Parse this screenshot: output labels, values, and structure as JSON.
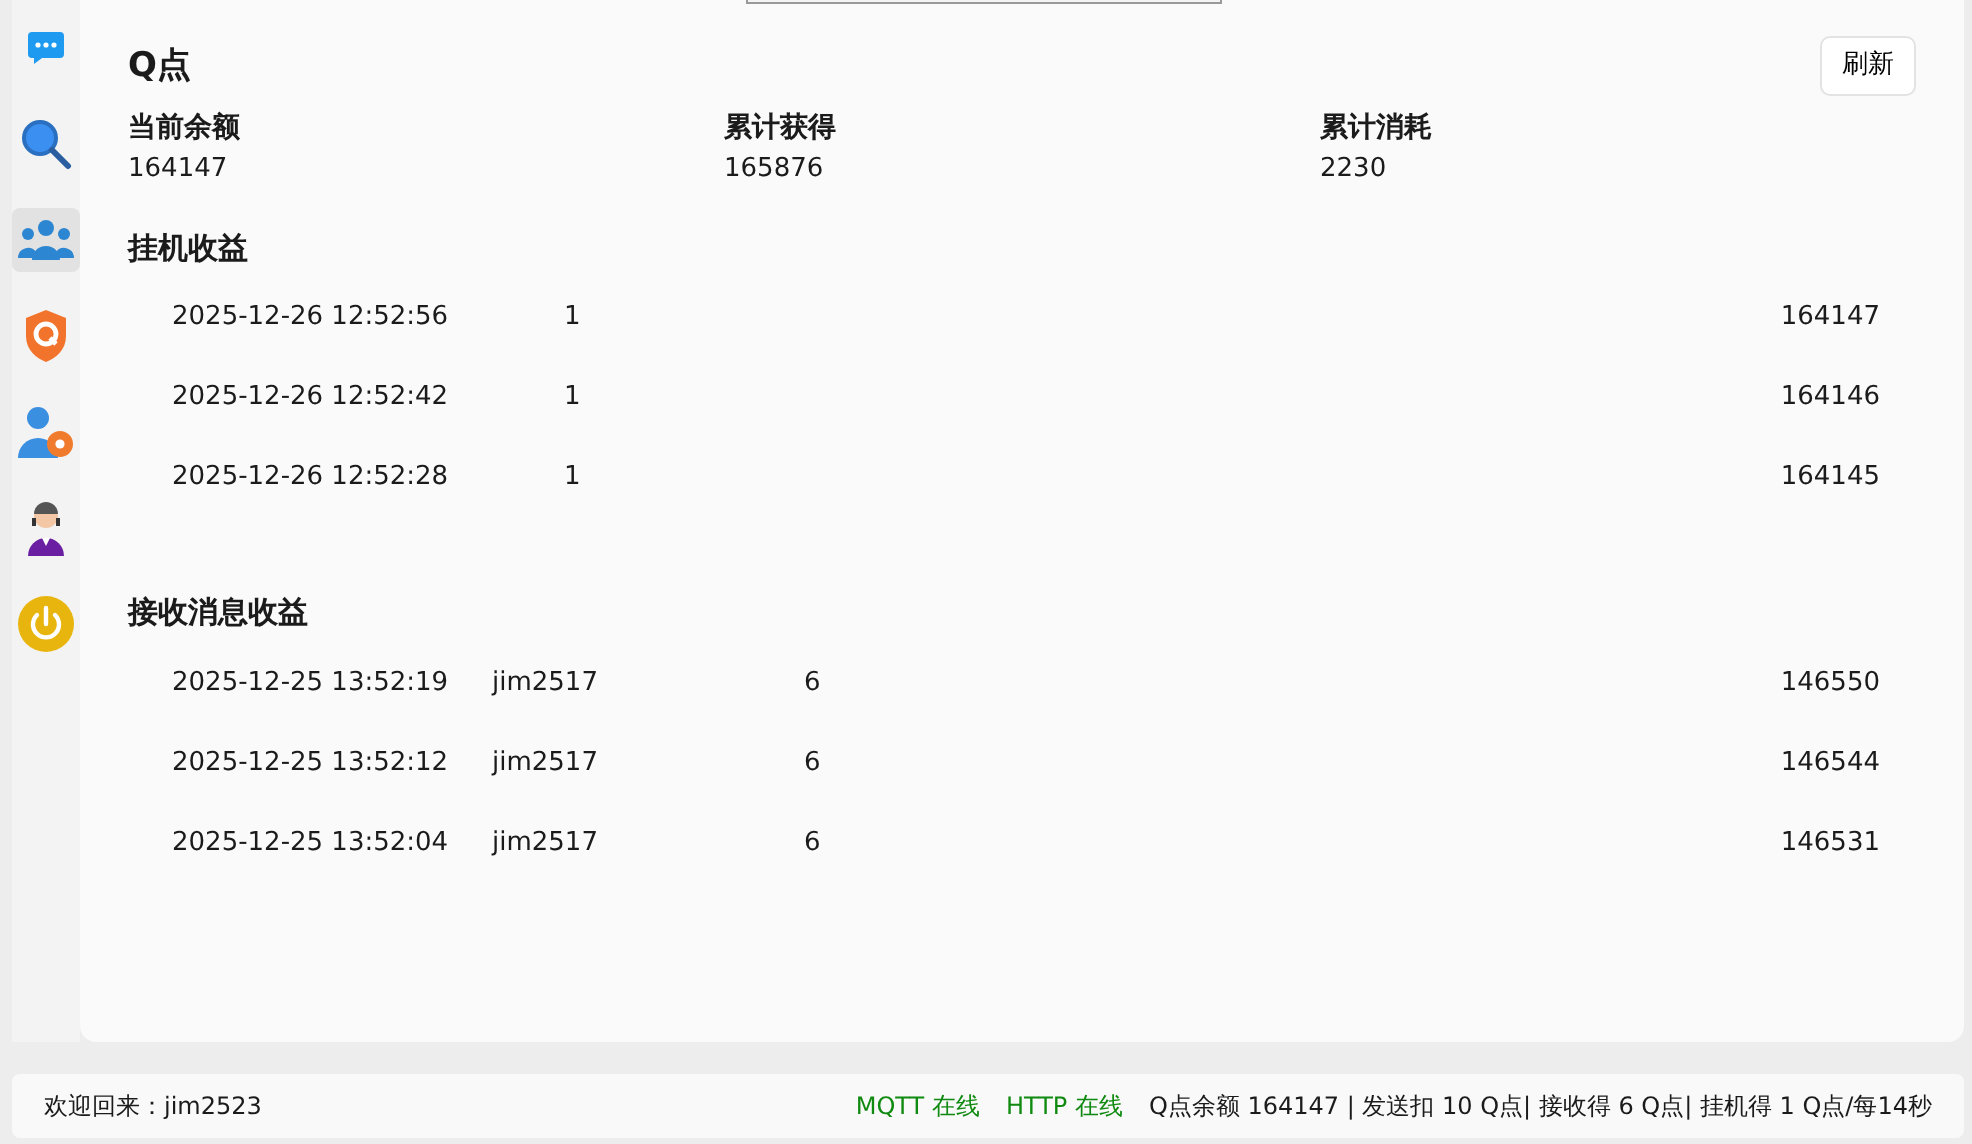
{
  "sidebar": {
    "items": [
      {
        "kind": "chat",
        "selected": false
      },
      {
        "kind": "search",
        "selected": false
      },
      {
        "kind": "group",
        "selected": true
      },
      {
        "kind": "shield",
        "selected": false
      },
      {
        "kind": "user-settings",
        "selected": false
      },
      {
        "kind": "support",
        "selected": false
      },
      {
        "kind": "power",
        "selected": false
      }
    ]
  },
  "page": {
    "title": "Q点",
    "refresh_button": "刷新"
  },
  "stats": [
    {
      "label": "当前余额",
      "value": "164147"
    },
    {
      "label": "累计获得",
      "value": "165876"
    },
    {
      "label": "累计消耗",
      "value": "2230"
    }
  ],
  "sections": [
    {
      "title": "挂机收益",
      "rows": [
        {
          "time": "2025-12-26 12:52:56",
          "column_2": "1",
          "balance": "164147"
        },
        {
          "time": "2025-12-26 12:52:42",
          "column_2": "1",
          "balance": "164146"
        },
        {
          "time": "2025-12-26 12:52:28",
          "column_2": "1",
          "balance": "164145"
        }
      ]
    },
    {
      "title": "接收消息收益",
      "rows": [
        {
          "time": "2025-12-25 13:52:19",
          "user": "jim2517",
          "column_3": "6",
          "balance": "146550"
        },
        {
          "time": "2025-12-25 13:52:12",
          "user": "jim2517",
          "column_3": "6",
          "balance": "146544"
        },
        {
          "time": "2025-12-25 13:52:04",
          "user": "jim2517",
          "column_3": "6",
          "balance": "146531"
        }
      ]
    }
  ],
  "status_bar": {
    "welcome": "欢迎回来：jim2523",
    "mqtt": "MQTT 在线",
    "http": "HTTP 在线",
    "summary": "Q点余额 164147 | 发送扣 10 Q点| 接收得 6 Q点| 挂机得 1 Q点/每14秒"
  }
}
